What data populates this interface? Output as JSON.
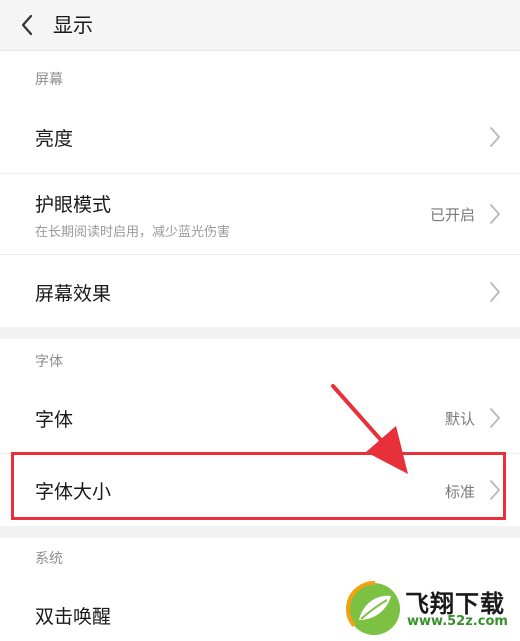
{
  "header": {
    "title": "显示"
  },
  "sections": {
    "screen": {
      "label": "屏幕"
    },
    "font": {
      "label": "字体"
    },
    "system": {
      "label": "系统"
    }
  },
  "rows": {
    "brightness": {
      "title": "亮度"
    },
    "eye_protection": {
      "title": "护眼模式",
      "subtitle": "在长期阅读时启用，减少蓝光伤害",
      "value": "已开启"
    },
    "screen_effect": {
      "title": "屏幕效果"
    },
    "font": {
      "title": "字体",
      "value": "默认"
    },
    "font_size": {
      "title": "字体大小",
      "value": "标准"
    },
    "double_tap_wake": {
      "title": "双击唤醒"
    }
  },
  "annotation": {
    "highlight_color": "#e8303a"
  },
  "watermark": {
    "brand": "飞翔下载",
    "domain": "www.52z.com"
  },
  "colors": {
    "header_bg": "#f5f5f5",
    "section_gap": "#f2f2f2",
    "secondary_text": "#8e8e8e",
    "annotation_red": "#e8303a",
    "watermark_green": "#3a8f2e"
  }
}
